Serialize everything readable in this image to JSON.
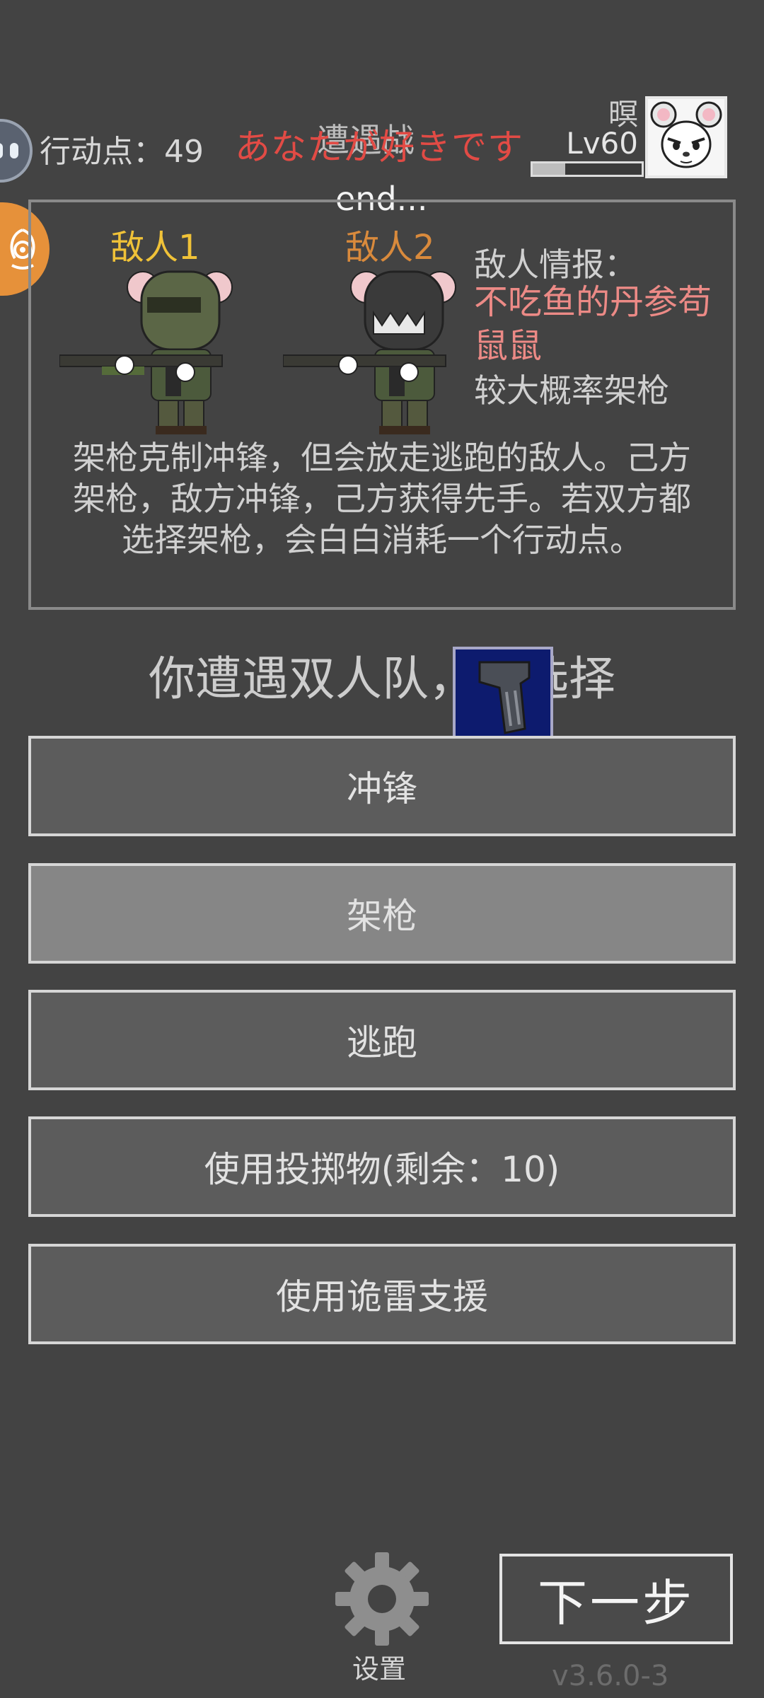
{
  "hud": {
    "action_points_label": "行动点：49",
    "encounter_title": "遭遇战",
    "overlay_love_text": "あなたが好きです",
    "loading_text": "end...",
    "player_name": "暝",
    "player_level": "Lv60",
    "xp_progress": 0.3
  },
  "enemies": [
    {
      "label": "敌人1",
      "helmet_color": "#5b6646"
    },
    {
      "label": "敌人2",
      "helmet_color": "#3a3a3a"
    }
  ],
  "intel": {
    "title": "敌人情报：",
    "enemy_name": "不吃鱼的丹参苟鼠鼠",
    "tendency": "较大概率架枪"
  },
  "rule_text": "架枪克制冲锋，但会放走逃跑的敌人。己方架枪，敌方冲锋，己方获得先手。若双方都选择架枪，会白白消耗一个行动点。",
  "prompt": "你遭遇双人队，请选择",
  "actions": [
    {
      "label": "冲锋",
      "active": false
    },
    {
      "label": "架枪",
      "active": true
    },
    {
      "label": "逃跑",
      "active": false
    },
    {
      "label": "使用投掷物(剩余：10)",
      "active": false
    },
    {
      "label": "使用诡雷支援",
      "active": false
    }
  ],
  "footer": {
    "settings_label": "设置",
    "next_label": "下一步",
    "version": "v3.6.0-3"
  },
  "colors": {
    "background": "#434343",
    "enemy1_label": "#f0c238",
    "enemy2_label": "#d98a3c",
    "intel_name": "#ec8a86",
    "overlay_love": "#e24b45",
    "item_bg": "#0d1b6e"
  },
  "icons": {
    "side_avatar": "robot-face-icon",
    "side_badge": "spiral-badge-icon",
    "item": "grip-icon",
    "settings": "gear-icon"
  }
}
